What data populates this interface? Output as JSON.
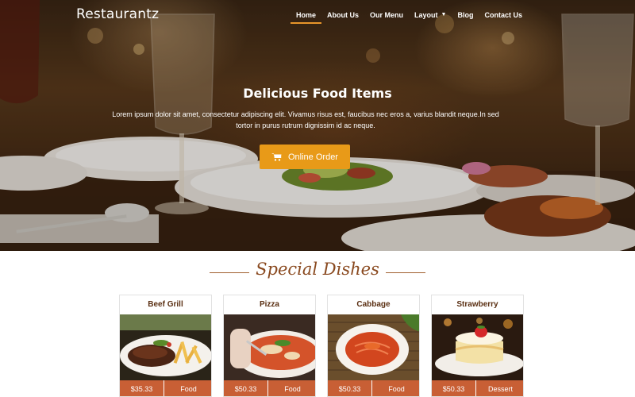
{
  "brand": "Restaurantz",
  "nav": {
    "items": [
      {
        "label": "Home"
      },
      {
        "label": "About Us"
      },
      {
        "label": "Our Menu"
      },
      {
        "label": "Layout"
      },
      {
        "label": "Blog"
      },
      {
        "label": "Contact Us"
      }
    ],
    "active": "Home"
  },
  "hero": {
    "title": "Delicious Food Items",
    "text": "Lorem ipsum dolor sit amet, consectetur adipiscing elit. Vivamus risus est, faucibus nec eros a, varius blandit neque.In sed tortor in purus rutrum dignissim id ac neque.",
    "button_label": "Online Order",
    "button_icon": "shopping-cart-icon"
  },
  "special": {
    "title": "Special Dishes",
    "dishes": [
      {
        "name": "Beef Grill",
        "price": "$35.33",
        "category": "Food"
      },
      {
        "name": "Pizza",
        "price": "$50.33",
        "category": "Food"
      },
      {
        "name": "Cabbage",
        "price": "$50.33",
        "category": "Food"
      },
      {
        "name": "Strawberry",
        "price": "$50.33",
        "category": "Dessert"
      }
    ]
  },
  "colors": {
    "accent": "#e89a18",
    "nav_underline": "#e8962a",
    "card_footer": "#c85f35",
    "title_brown": "#8a4a20"
  }
}
